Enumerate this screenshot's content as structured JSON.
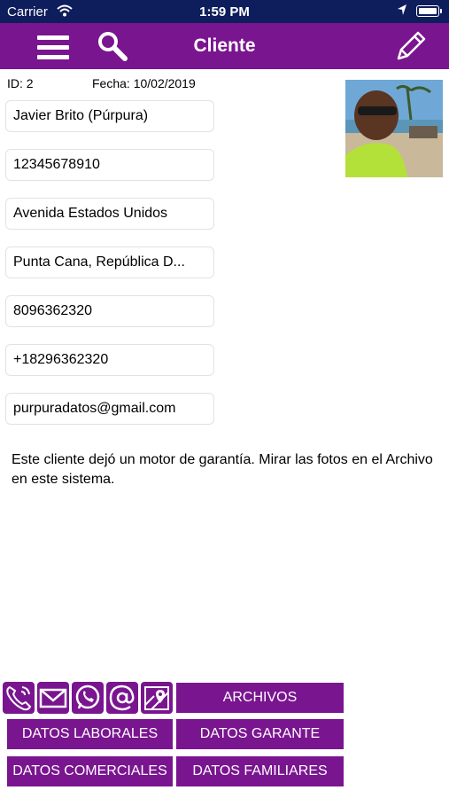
{
  "statusbar": {
    "carrier": "Carrier",
    "time": "1:59 PM"
  },
  "navbar": {
    "title": "Cliente"
  },
  "cliente": {
    "id_text": "ID: 2",
    "fecha_text": "Fecha: 10/02/2019",
    "nombre": "Javier Brito (Púrpura)",
    "cedula": "12345678910",
    "direccion": "Avenida Estados Unidos",
    "ciudad": "Punta Cana, República D...",
    "telefono": "8096362320",
    "celular": "+18296362320",
    "email": "purpuradatos@gmail.com",
    "nota": "Este cliente dejó un motor de garantía. Mirar las fotos en el Archivo en este sistema."
  },
  "actions": {
    "archivos": "ARCHIVOS",
    "datos_laborales": "DATOS LABORALES",
    "datos_garante": "DATOS GARANTE",
    "datos_comerciales": "DATOS COMERCIALES",
    "datos_familiares": "DATOS FAMILIARES"
  },
  "icons": [
    "phone-icon",
    "mail-icon",
    "whatsapp-icon",
    "at-icon",
    "map-icon",
    "menu-icon",
    "search-icon",
    "edit-icon"
  ],
  "colors": {
    "primary": "#7a1590",
    "statusbar": "#0e1d5c"
  }
}
